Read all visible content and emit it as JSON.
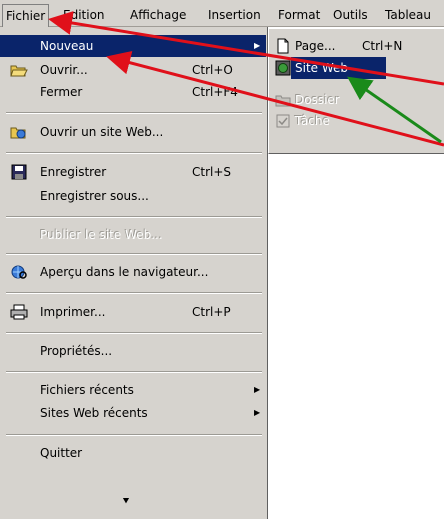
{
  "menubar": {
    "items": [
      "Fichier",
      "Edition",
      "Affichage",
      "Insertion",
      "Format",
      "Outils",
      "Tableau"
    ]
  },
  "menu": {
    "items": [
      {
        "label": "Nouveau",
        "shortcut": "",
        "submenu": true,
        "icon": "none"
      },
      {
        "label": "Ouvrir...",
        "shortcut": "Ctrl+O",
        "icon": "open-folder-icon"
      },
      {
        "label": "Fermer",
        "shortcut": "Ctrl+F4",
        "icon": "none"
      },
      {
        "label": "Ouvrir un site Web...",
        "icon": "open-web-folder-icon"
      },
      {
        "label": "Enregistrer",
        "shortcut": "Ctrl+S",
        "icon": "floppy-disk-icon"
      },
      {
        "label": "Enregistrer sous...",
        "icon": "none"
      },
      {
        "label": "Publier le site Web...",
        "disabled": true,
        "icon": "none"
      },
      {
        "label": "Aperçu dans le navigateur...",
        "icon": "browser-preview-icon"
      },
      {
        "label": "Imprimer...",
        "shortcut": "Ctrl+P",
        "icon": "printer-icon"
      },
      {
        "label": "Propriétés...",
        "icon": "none"
      },
      {
        "label": "Fichiers récents",
        "submenu": true
      },
      {
        "label": "Sites Web récents",
        "submenu": true
      },
      {
        "label": "Quitter"
      }
    ]
  },
  "submenu": {
    "items": [
      {
        "label": "Page...",
        "shortcut": "Ctrl+N",
        "icon": "page-icon"
      },
      {
        "label": "Site Web",
        "icon": "website-icon",
        "selected": true
      },
      {
        "label": "Dossier",
        "disabled": true,
        "icon": "folder-icon"
      },
      {
        "label": "Tâche",
        "disabled": true,
        "icon": "task-icon"
      }
    ]
  },
  "colors": {
    "menu_bg": "#d6d3ce",
    "highlight": "#0a246a",
    "arrow_red": "#e0101a",
    "arrow_green": "#1a8a1a"
  }
}
